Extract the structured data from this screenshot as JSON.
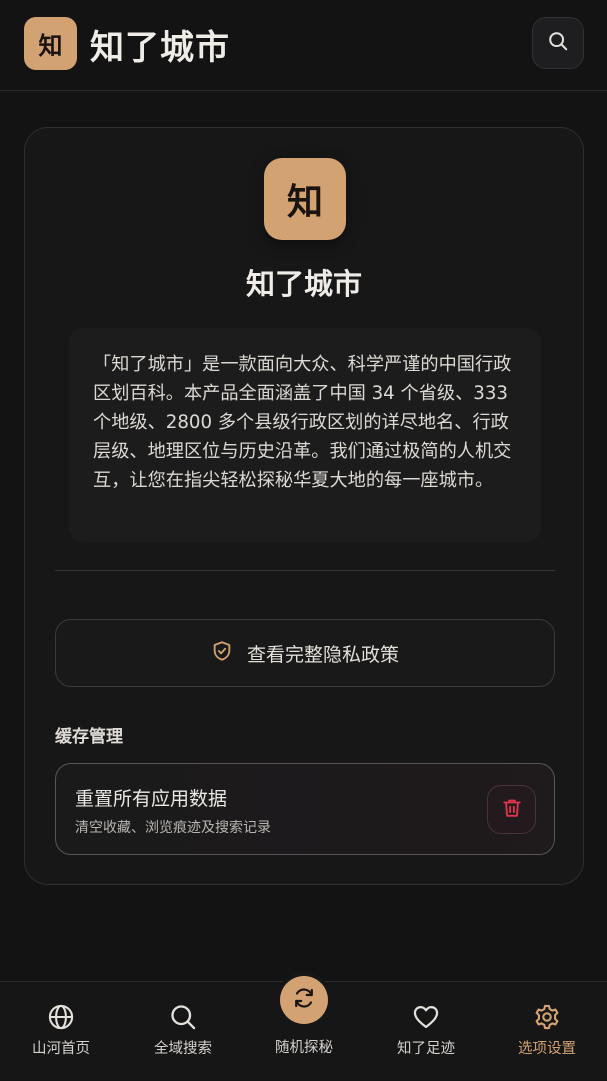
{
  "header": {
    "logo_char": "知",
    "title": "知了城市"
  },
  "about": {
    "logo_char": "知",
    "title": "知了城市",
    "description": "「知了城市」是一款面向大众、科学严谨的中国行政区划百科。本产品全面涵盖了中国 34 个省级、333 个地级、2800 多个县级行政区划的详尽地名、行政层级、地理区位与历史沿革。我们通过极简的人机交互，让您在指尖轻松探秘华夏大地的每一座城市。",
    "privacy_button": "查看完整隐私政策"
  },
  "cache": {
    "section_title": "缓存管理",
    "reset_title": "重置所有应用数据",
    "reset_subtitle": "清空收藏、浏览痕迹及搜索记录"
  },
  "nav": {
    "items": [
      {
        "label": "山河首页",
        "icon": "globe-icon"
      },
      {
        "label": "全域搜索",
        "icon": "search-icon"
      },
      {
        "label": "随机探秘",
        "icon": "refresh-icon"
      },
      {
        "label": "知了足迹",
        "icon": "heart-icon"
      },
      {
        "label": "选项设置",
        "icon": "gear-icon",
        "active": true
      }
    ]
  },
  "colors": {
    "accent": "#d3a272",
    "danger": "#e0334c",
    "background": "#131314"
  }
}
